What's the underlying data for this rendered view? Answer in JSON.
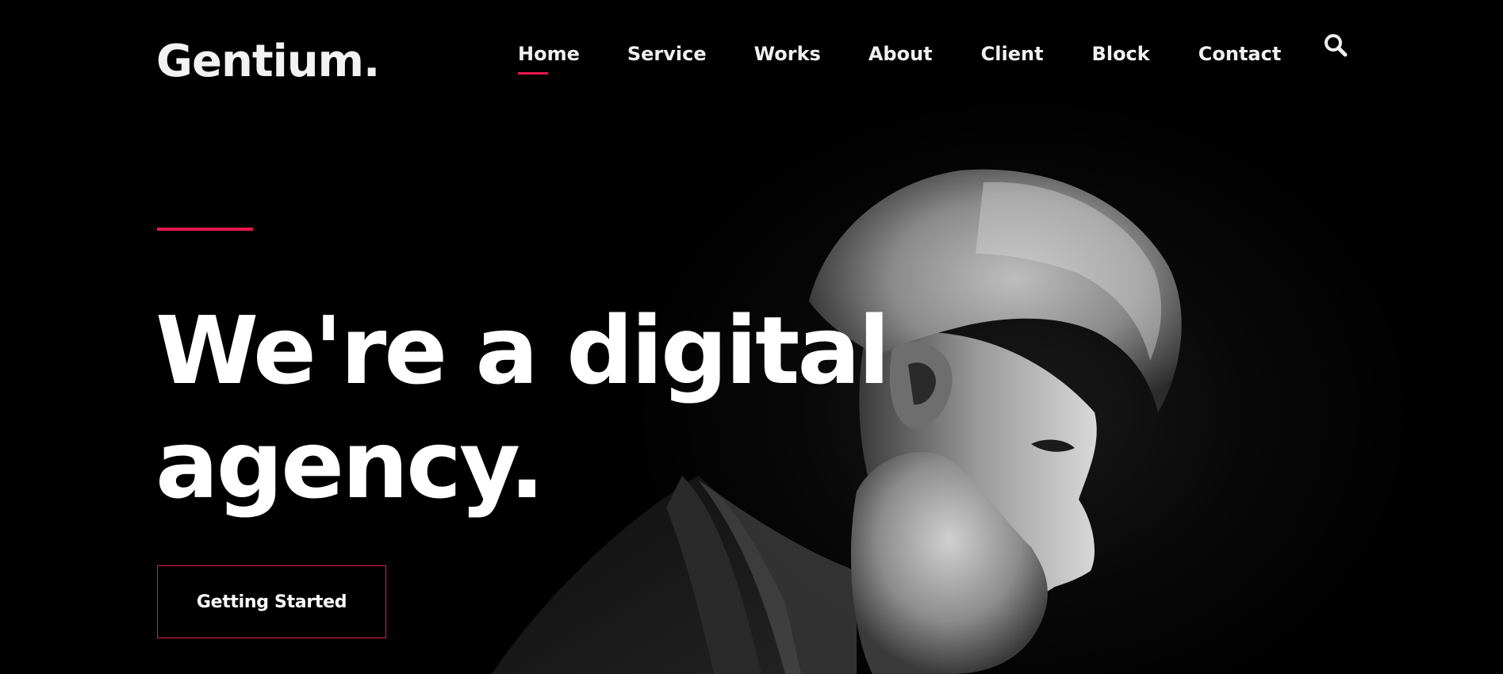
{
  "brand": {
    "logo_text": "Gentium."
  },
  "nav": {
    "items": [
      {
        "label": "Home",
        "active": true
      },
      {
        "label": "Service",
        "active": false
      },
      {
        "label": "Works",
        "active": false
      },
      {
        "label": "About",
        "active": false
      },
      {
        "label": "Client",
        "active": false
      },
      {
        "label": "Block",
        "active": false
      },
      {
        "label": "Contact",
        "active": false
      }
    ],
    "search_icon": "search-icon"
  },
  "hero": {
    "headline_line1": "We're a digital",
    "headline_line2": "agency.",
    "cta_label": "Getting Started",
    "image": "black-and-white portrait of a bearded man with swept-back grey hair, profile facing right"
  },
  "colors": {
    "background": "#000000",
    "accent": "#e8174b",
    "text": "#ffffff"
  }
}
